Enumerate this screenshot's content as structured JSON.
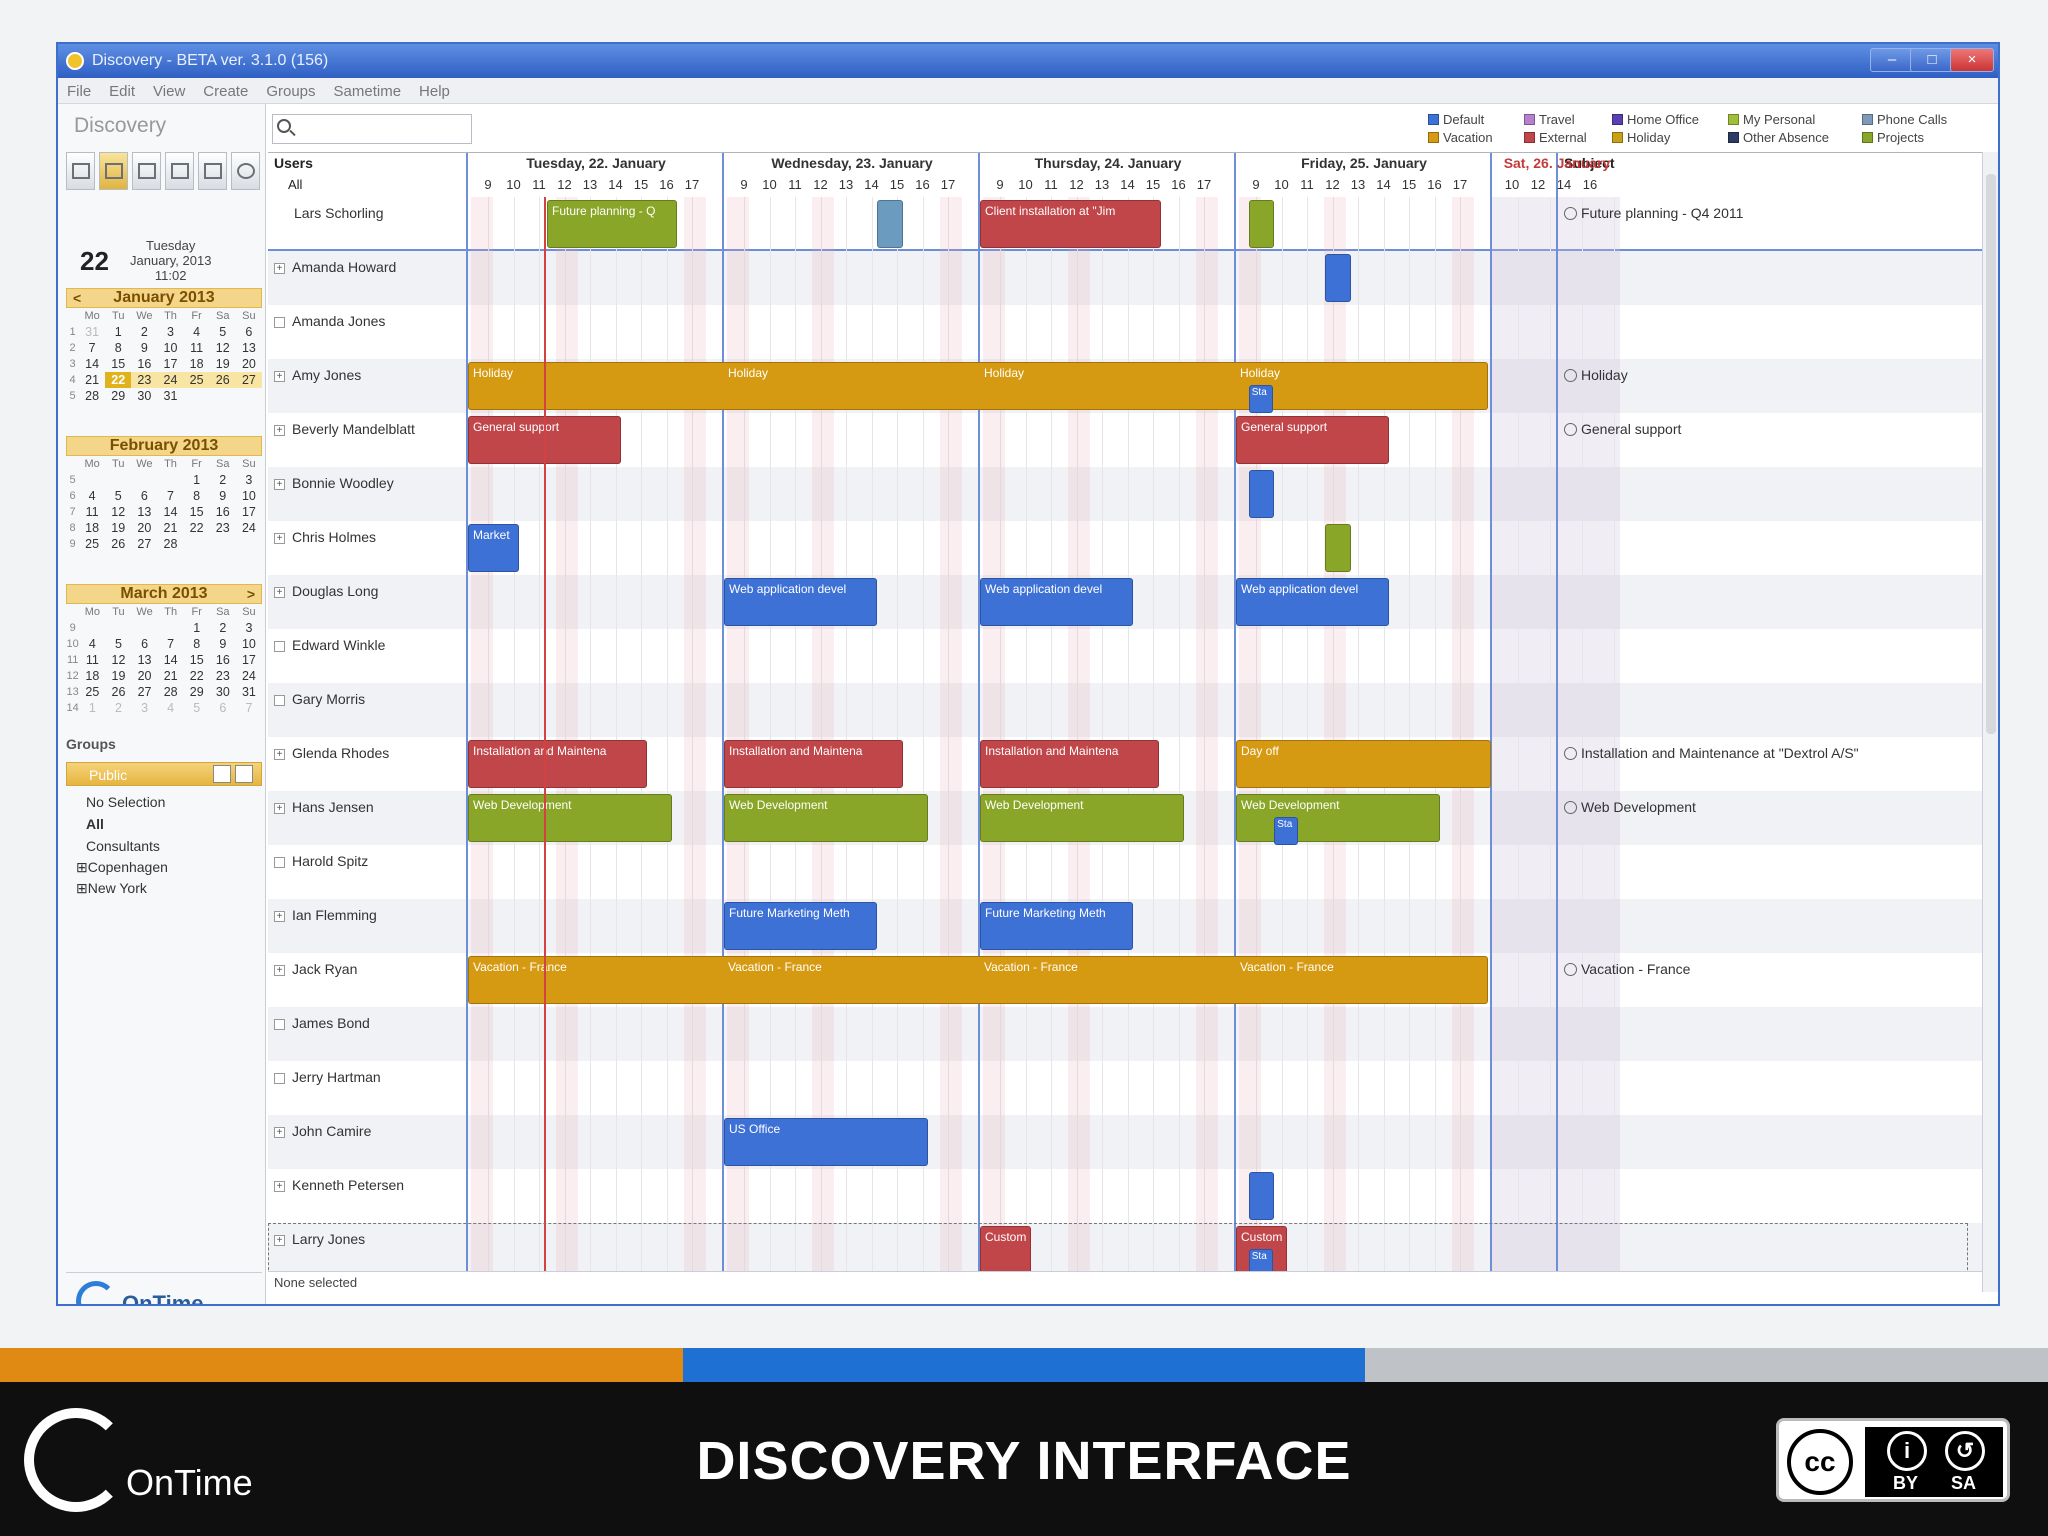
{
  "window": {
    "title": "Discovery - BETA ver. 3.1.0 (156)",
    "min": "‒",
    "max": "□",
    "close": "×"
  },
  "menu": [
    "File",
    "Edit",
    "View",
    "Create",
    "Groups",
    "Sametime",
    "Help"
  ],
  "app_name": "Discovery",
  "today": {
    "day": "22",
    "weekday": "Tuesday",
    "monthyear": "January, 2013",
    "time": "11:02"
  },
  "calendars": [
    {
      "month": "January 2013",
      "rows": [
        [
          "1",
          "31",
          "1",
          "2",
          "3",
          "4",
          "5",
          "6"
        ],
        [
          "2",
          "7",
          "8",
          "9",
          "10",
          "11",
          "12",
          "13"
        ],
        [
          "3",
          "14",
          "15",
          "16",
          "17",
          "18",
          "19",
          "20"
        ],
        [
          "4",
          "21",
          "22",
          "23",
          "24",
          "25",
          "26",
          "27"
        ],
        [
          "5",
          "28",
          "29",
          "30",
          "31",
          "",
          "",
          ""
        ]
      ]
    },
    {
      "month": "February 2013",
      "rows": [
        [
          "5",
          "",
          "",
          "",
          "",
          "1",
          "2",
          "3"
        ],
        [
          "6",
          "4",
          "5",
          "6",
          "7",
          "8",
          "9",
          "10"
        ],
        [
          "7",
          "11",
          "12",
          "13",
          "14",
          "15",
          "16",
          "17"
        ],
        [
          "8",
          "18",
          "19",
          "20",
          "21",
          "22",
          "23",
          "24"
        ],
        [
          "9",
          "25",
          "26",
          "27",
          "28",
          "",
          "",
          ""
        ]
      ]
    },
    {
      "month": "March 2013",
      "rows": [
        [
          "9",
          "",
          "",
          "",
          "",
          "1",
          "2",
          "3"
        ],
        [
          "10",
          "4",
          "5",
          "6",
          "7",
          "8",
          "9",
          "10"
        ],
        [
          "11",
          "11",
          "12",
          "13",
          "14",
          "15",
          "16",
          "17"
        ],
        [
          "12",
          "18",
          "19",
          "20",
          "21",
          "22",
          "23",
          "24"
        ],
        [
          "13",
          "25",
          "26",
          "27",
          "28",
          "29",
          "30",
          "31"
        ],
        [
          "14",
          "1",
          "2",
          "3",
          "4",
          "5",
          "6",
          "7"
        ]
      ]
    }
  ],
  "weekday_header": [
    "Mo",
    "Tu",
    "We",
    "Th",
    "Fr",
    "Sa",
    "Su"
  ],
  "groups": {
    "title": "Groups",
    "selected": "Public",
    "items": [
      "No Selection",
      "All",
      "Consultants",
      "Copenhagen",
      "New York"
    ]
  },
  "brand": "OnTime",
  "legend": [
    {
      "label": "Default",
      "color": "#3d71d6"
    },
    {
      "label": "Travel",
      "color": "#b77fd0"
    },
    {
      "label": "Home Office",
      "color": "#5a3fb0"
    },
    {
      "label": "My Personal",
      "color": "#9fbf3a"
    },
    {
      "label": "Phone Calls",
      "color": "#7e9ab8"
    },
    {
      "label": "Vacation",
      "color": "#d69a12"
    },
    {
      "label": "External",
      "color": "#c0464a"
    },
    {
      "label": "Holiday",
      "color": "#c9a116"
    },
    {
      "label": "Other Absence",
      "color": "#2d3a63"
    },
    {
      "label": "Projects",
      "color": "#8aa628"
    }
  ],
  "grid": {
    "users_header": "Users",
    "all": "All",
    "subject_header": "Subject",
    "days": [
      {
        "label": "Tuesday, 22. January",
        "hours": [
          "9",
          "10",
          "11",
          "12",
          "13",
          "14",
          "15",
          "16",
          "17"
        ]
      },
      {
        "label": "Wednesday, 23. January",
        "hours": [
          "9",
          "10",
          "11",
          "12",
          "13",
          "14",
          "15",
          "16",
          "17"
        ]
      },
      {
        "label": "Thursday, 24. January",
        "hours": [
          "9",
          "10",
          "11",
          "12",
          "13",
          "14",
          "15",
          "16",
          "17"
        ]
      },
      {
        "label": "Friday, 25. January",
        "hours": [
          "9",
          "10",
          "11",
          "12",
          "13",
          "14",
          "15",
          "16",
          "17"
        ]
      },
      {
        "label": "Sat, 26. January",
        "hours": [
          "10",
          "12",
          "14",
          "16"
        ]
      }
    ],
    "users": [
      {
        "name": "Lars Schorling",
        "subject": "Future planning - Q4 2011"
      },
      {
        "name": "Amanda Howard",
        "subject": ""
      },
      {
        "name": "Amanda Jones",
        "subject": ""
      },
      {
        "name": "Amy Jones",
        "subject": "Holiday"
      },
      {
        "name": "Beverly Mandelblatt",
        "subject": "General support"
      },
      {
        "name": "Bonnie Woodley",
        "subject": ""
      },
      {
        "name": "Chris Holmes",
        "subject": ""
      },
      {
        "name": "Douglas Long",
        "subject": ""
      },
      {
        "name": "Edward Winkle",
        "subject": ""
      },
      {
        "name": "Gary Morris",
        "subject": ""
      },
      {
        "name": "Glenda Rhodes",
        "subject": "Installation and Maintenance at \"Dextrol A/S\""
      },
      {
        "name": "Hans Jensen",
        "subject": "Web Development"
      },
      {
        "name": "Harold Spitz",
        "subject": ""
      },
      {
        "name": "Ian Flemming",
        "subject": ""
      },
      {
        "name": "Jack Ryan",
        "subject": "Vacation - France"
      },
      {
        "name": "James Bond",
        "subject": ""
      },
      {
        "name": "Jerry Hartman",
        "subject": ""
      },
      {
        "name": "John Camire",
        "subject": ""
      },
      {
        "name": "Kenneth Petersen",
        "subject": ""
      },
      {
        "name": "Larry Jones",
        "subject": ""
      }
    ],
    "event_labels": {
      "future_planning": "Future planning - Q",
      "client_installation": "Client installation at \"Jim",
      "holiday": "Holiday",
      "sta": "Sta",
      "general_support": "General support",
      "market": "Market",
      "web_app_dev": "Web application devel",
      "installation": "Installation and Maintena",
      "day_off": "Day off",
      "web_development": "Web Development",
      "future_marketing": "Future Marketing Meth",
      "vacation_france": "Vacation - France",
      "us_office": "US Office",
      "custom": "Custom"
    },
    "status": "None selected"
  },
  "footer": {
    "title": "DISCOVERY INTERFACE",
    "brand": "OnTime",
    "cc_by": "BY",
    "cc_sa": "SA",
    "cc": "cc"
  }
}
